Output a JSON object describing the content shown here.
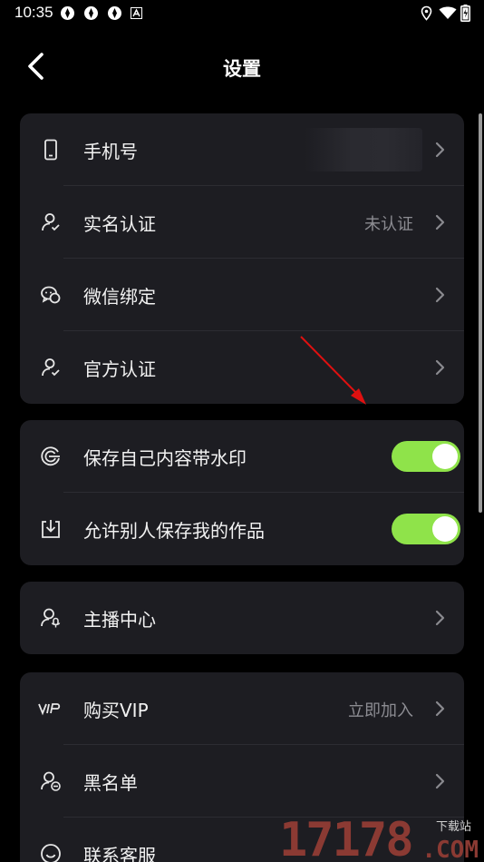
{
  "status_bar": {
    "time": "10:35"
  },
  "header": {
    "title": "设置"
  },
  "account_card": [
    {
      "label": "手机号",
      "value": ""
    },
    {
      "label": "实名认证",
      "value": "未认证"
    },
    {
      "label": "微信绑定",
      "value": ""
    },
    {
      "label": "官方认证",
      "value": ""
    }
  ],
  "privacy_card": [
    {
      "label": "保存自己内容带水印",
      "enabled": true
    },
    {
      "label": "允许别人保存我的作品",
      "enabled": true
    }
  ],
  "anchor_card": [
    {
      "label": "主播中心"
    }
  ],
  "more_card": [
    {
      "label": "购买VIP",
      "value": "立即加入"
    },
    {
      "label": "黑名单",
      "value": ""
    },
    {
      "label": "联系客服",
      "value": ""
    }
  ],
  "watermark": {
    "number": "17178",
    "small": "下载站",
    "domain": ".COM"
  },
  "colors": {
    "background": "#000000",
    "card": "#1d1d22",
    "toggle_on": "#8fe34a",
    "annotation_arrow": "#e01010"
  }
}
